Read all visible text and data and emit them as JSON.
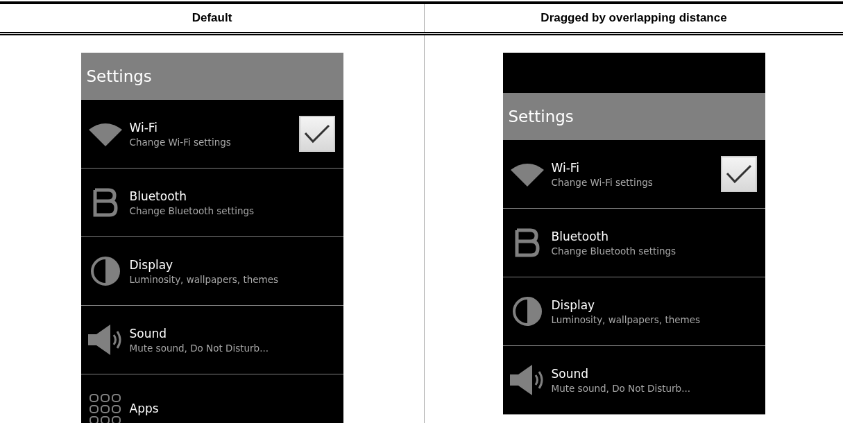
{
  "columns": [
    {
      "heading": "Default",
      "screen": {
        "dragged": false,
        "title": "Settings",
        "items": [
          {
            "kind": "checkbox",
            "title": "Wi-Fi",
            "subtitle": "Change Wi-Fi settings",
            "checked": true
          },
          {
            "kind": "plain",
            "title": "Bluetooth",
            "subtitle": "Change Bluetooth settings"
          },
          {
            "kind": "plain",
            "title": "Display",
            "subtitle": "Luminosity, wallpapers, themes"
          },
          {
            "kind": "plain",
            "title": "Sound",
            "subtitle": "Mute sound, Do Not Disturb..."
          },
          {
            "kind": "plain",
            "title": "Apps"
          }
        ]
      }
    },
    {
      "heading": "Dragged by overlapping distance",
      "screen": {
        "dragged": true,
        "title": "Settings",
        "items": [
          {
            "kind": "checkbox",
            "title": "Wi-Fi",
            "subtitle": "Change Wi-Fi settings",
            "checked": true
          },
          {
            "kind": "plain",
            "title": "Bluetooth",
            "subtitle": "Change Bluetooth settings"
          },
          {
            "kind": "plain",
            "title": "Display",
            "subtitle": "Luminosity, wallpapers, themes"
          },
          {
            "kind": "plain",
            "title": "Sound",
            "subtitle": "Mute sound, Do Not Disturb..."
          }
        ]
      }
    }
  ]
}
